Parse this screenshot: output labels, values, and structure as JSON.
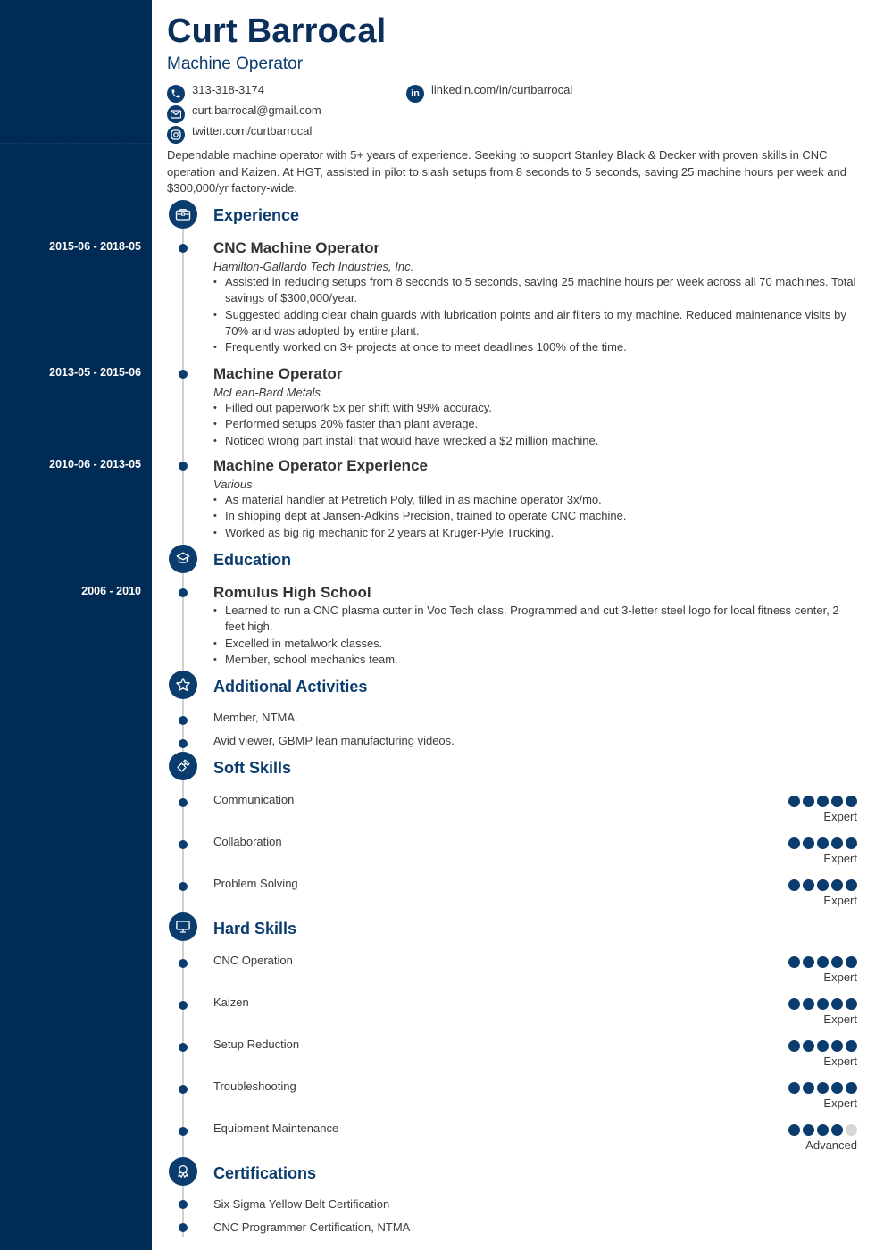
{
  "header": {
    "name": "Curt Barrocal",
    "title": "Machine Operator"
  },
  "contact": {
    "phone": "313-318-3174",
    "email": "curt.barrocal@gmail.com",
    "twitter": "twitter.com/curtbarrocal",
    "linkedin": "linkedin.com/in/curtbarrocal"
  },
  "summary": "Dependable machine operator with 5+ years of experience. Seeking to support Stanley Black & Decker with proven skills in CNC operation and Kaizen. At HGT, assisted in pilot to slash setups from 8 seconds to 5 seconds, saving 25 machine hours per week and $300,000/yr factory-wide.",
  "experience": {
    "heading": "Experience",
    "icon": "briefcase-icon",
    "jobs": [
      {
        "dates": "2015-06 - 2018-05",
        "title": "CNC Machine Operator",
        "company": "Hamilton-Gallardo Tech Industries, Inc.",
        "bullets": [
          "Assisted in reducing setups from 8 seconds to 5 seconds, saving 25 machine hours per week across all 70 machines. Total savings of $300,000/year.",
          "Suggested adding clear chain guards with lubrication points and air filters to my machine. Reduced maintenance visits by 70% and was adopted by entire plant.",
          "Frequently worked on 3+ projects at once to meet deadlines 100% of the time."
        ]
      },
      {
        "dates": "2013-05 - 2015-06",
        "title": "Machine Operator",
        "company": "McLean-Bard Metals",
        "bullets": [
          "Filled out paperwork 5x per shift with 99% accuracy.",
          "Performed setups 20% faster than plant average.",
          "Noticed wrong part install that would have wrecked a $2 million machine."
        ]
      },
      {
        "dates": "2010-06 - 2013-05",
        "title": "Machine Operator Experience",
        "company": "Various",
        "bullets": [
          "As material handler at Petretich Poly, filled in as machine operator 3x/mo.",
          "In shipping dept at Jansen-Adkins Precision, trained to operate CNC machine.",
          "Worked as big rig mechanic for 2 years at Kruger-Pyle Trucking."
        ]
      }
    ]
  },
  "education": {
    "heading": "Education",
    "icon": "graduation-cap-icon",
    "items": [
      {
        "dates": "2006 - 2010",
        "school": "Romulus High School",
        "bullets": [
          "Learned to run a CNC plasma cutter in Voc Tech class. Programmed and cut 3-letter steel logo for local fitness center, 2 feet high.",
          "Excelled in metalwork classes.",
          "Member, school mechanics team."
        ]
      }
    ]
  },
  "activities": {
    "heading": "Additional Activities",
    "icon": "star-icon",
    "items": [
      "Member, NTMA.",
      "Avid viewer, GBMP lean manufacturing videos."
    ]
  },
  "soft_skills": {
    "heading": "Soft Skills",
    "icon": "puzzle-icon",
    "items": [
      {
        "name": "Communication",
        "rating": 5,
        "max": 5,
        "level": "Expert"
      },
      {
        "name": "Collaboration",
        "rating": 5,
        "max": 5,
        "level": "Expert"
      },
      {
        "name": "Problem Solving",
        "rating": 5,
        "max": 5,
        "level": "Expert"
      }
    ]
  },
  "hard_skills": {
    "heading": "Hard Skills",
    "icon": "monitor-icon",
    "items": [
      {
        "name": "CNC Operation",
        "rating": 5,
        "max": 5,
        "level": "Expert"
      },
      {
        "name": "Kaizen",
        "rating": 5,
        "max": 5,
        "level": "Expert"
      },
      {
        "name": "Setup Reduction",
        "rating": 5,
        "max": 5,
        "level": "Expert"
      },
      {
        "name": "Troubleshooting",
        "rating": 5,
        "max": 5,
        "level": "Expert"
      },
      {
        "name": "Equipment Maintenance",
        "rating": 4,
        "max": 5,
        "level": "Advanced"
      }
    ]
  },
  "certifications": {
    "heading": "Certifications",
    "icon": "award-icon",
    "items": [
      "Six Sigma Yellow Belt Certification",
      "CNC Programmer Certification, NTMA"
    ]
  },
  "colors": {
    "sidebar": "#002b55",
    "accent": "#0b3c6e",
    "text": "#3a3a3a",
    "rating_off": "#d6d6d6"
  }
}
